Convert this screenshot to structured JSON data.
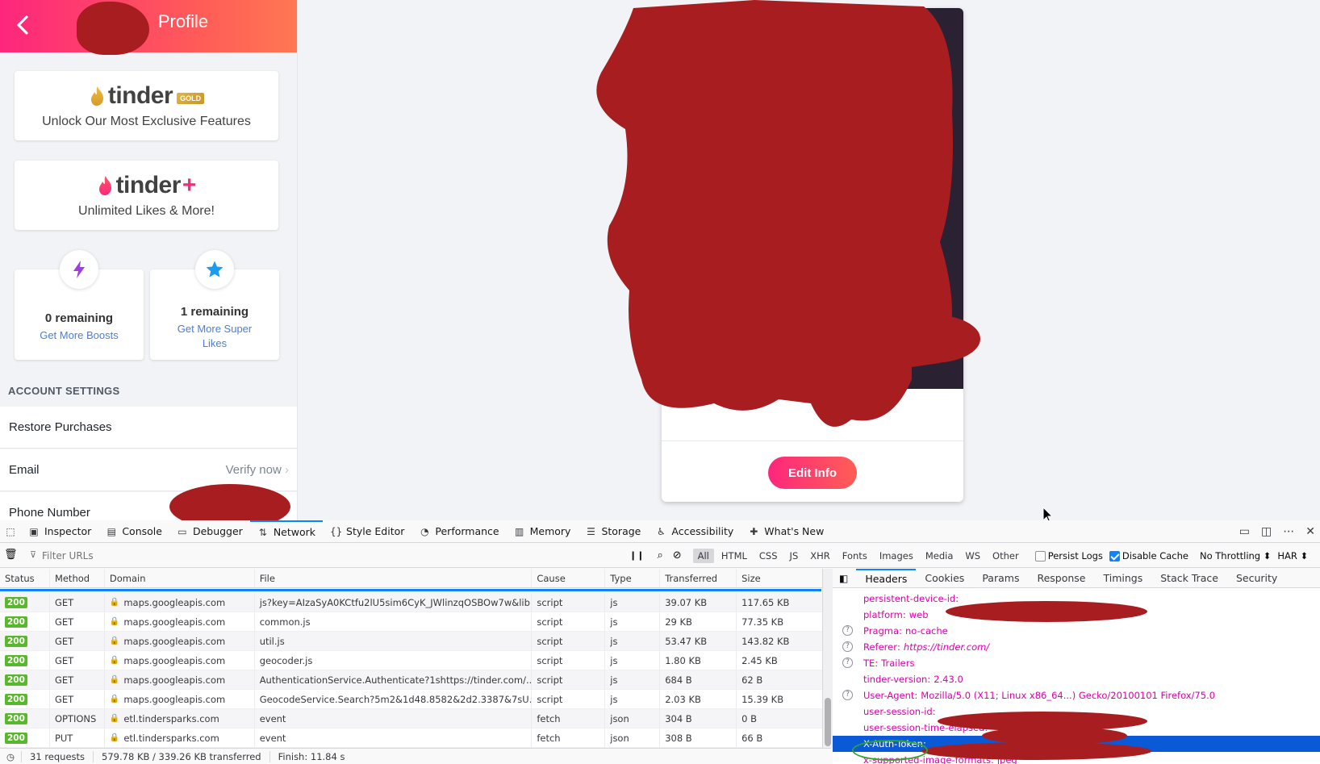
{
  "app": {
    "header_title": "Profile",
    "gold_card": {
      "logo_word": "tinder",
      "badge": "GOLD",
      "subtitle": "Unlock Our Most Exclusive Features"
    },
    "plus_card": {
      "logo_word": "tinder",
      "plus": "+",
      "subtitle": "Unlimited Likes & More!"
    },
    "boosts": {
      "remaining": "0 remaining",
      "link": "Get More Boosts"
    },
    "super_likes": {
      "remaining": "1 remaining",
      "link": "Get More Super Likes"
    },
    "account_settings_header": "ACCOUNT SETTINGS",
    "settings": [
      {
        "label": "Restore Purchases",
        "value": ""
      },
      {
        "label": "Email",
        "value": "Verify now"
      },
      {
        "label": "Phone Number",
        "value": ""
      }
    ],
    "edit_info_button": "Edit Info",
    "colors": {
      "brand_start": "#fd267d",
      "brand_end": "#ff7854",
      "link": "#4c7ed6",
      "redaction": "#a71d20"
    }
  },
  "devtools": {
    "tabs": [
      {
        "label": "Inspector",
        "icon": "inspector-icon"
      },
      {
        "label": "Console",
        "icon": "console-icon"
      },
      {
        "label": "Debugger",
        "icon": "debugger-icon"
      },
      {
        "label": "Network",
        "icon": "network-icon",
        "active": true
      },
      {
        "label": "Style Editor",
        "icon": "style-editor-icon"
      },
      {
        "label": "Performance",
        "icon": "performance-icon"
      },
      {
        "label": "Memory",
        "icon": "memory-icon"
      },
      {
        "label": "Storage",
        "icon": "storage-icon"
      },
      {
        "label": "Accessibility",
        "icon": "accessibility-icon"
      },
      {
        "label": "What's New",
        "icon": "whats-new-icon"
      }
    ],
    "toolbar": {
      "filter_placeholder": "Filter URLs",
      "type_filters": [
        "All",
        "HTML",
        "CSS",
        "JS",
        "XHR",
        "Fonts",
        "Images",
        "Media",
        "WS",
        "Other"
      ],
      "active_filter": "All",
      "persist_logs": "Persist Logs",
      "disable_cache": "Disable Cache",
      "throttling": "No Throttling",
      "har": "HAR"
    },
    "columns": [
      "Status",
      "Method",
      "Domain",
      "File",
      "Cause",
      "Type",
      "Transferred",
      "Size"
    ],
    "requests": [
      {
        "status": "200",
        "method": "GET",
        "domain": "maps.googleapis.com",
        "file": "js?key=AIzaSyA0KCtfu2lU5sim6CyK_JWlinzqOSBOw7w&lib...",
        "cause": "script",
        "type": "js",
        "transferred": "39.07 KB",
        "size": "117.65 KB"
      },
      {
        "status": "200",
        "method": "GET",
        "domain": "maps.googleapis.com",
        "file": "common.js",
        "cause": "script",
        "type": "js",
        "transferred": "29 KB",
        "size": "77.35 KB"
      },
      {
        "status": "200",
        "method": "GET",
        "domain": "maps.googleapis.com",
        "file": "util.js",
        "cause": "script",
        "type": "js",
        "transferred": "53.47 KB",
        "size": "143.82 KB"
      },
      {
        "status": "200",
        "method": "GET",
        "domain": "maps.googleapis.com",
        "file": "geocoder.js",
        "cause": "script",
        "type": "js",
        "transferred": "1.80 KB",
        "size": "2.45 KB"
      },
      {
        "status": "200",
        "method": "GET",
        "domain": "maps.googleapis.com",
        "file": "AuthenticationService.Authenticate?1shttps://tinder.com/...",
        "cause": "script",
        "type": "js",
        "transferred": "684 B",
        "size": "62 B"
      },
      {
        "status": "200",
        "method": "GET",
        "domain": "maps.googleapis.com",
        "file": "GeocodeService.Search?5m2&1d48.8582&2d2.3387&7sU...",
        "cause": "script",
        "type": "js",
        "transferred": "2.03 KB",
        "size": "15.39 KB"
      },
      {
        "status": "200",
        "method": "OPTIONS",
        "domain": "etl.tindersparks.com",
        "file": "event",
        "cause": "fetch",
        "type": "json",
        "transferred": "304 B",
        "size": "0 B"
      },
      {
        "status": "200",
        "method": "PUT",
        "domain": "etl.tindersparks.com",
        "file": "event",
        "cause": "fetch",
        "type": "json",
        "transferred": "308 B",
        "size": "66 B"
      }
    ],
    "status_bar": {
      "requests": "31 requests",
      "transferred": "579.78 KB / 339.26 KB transferred",
      "finish": "Finish: 11.84 s"
    },
    "detail_tabs": [
      "Headers",
      "Cookies",
      "Params",
      "Response",
      "Timings",
      "Stack Trace",
      "Security"
    ],
    "active_detail_tab": "Headers",
    "headers": [
      {
        "name": "persistent-device-id",
        "value": "",
        "help": false
      },
      {
        "name": "platform",
        "value": "web",
        "help": false
      },
      {
        "name": "Pragma",
        "value": "no-cache",
        "help": true
      },
      {
        "name": "Referer",
        "value": "https://tinder.com/",
        "help": true
      },
      {
        "name": "TE",
        "value": "Trailers",
        "help": true
      },
      {
        "name": "tinder-version",
        "value": "2.43.0",
        "help": false
      },
      {
        "name": "User-Agent",
        "value": "Mozilla/5.0 (X11; Linux x86_64...) Gecko/20100101 Firefox/75.0",
        "help": true
      },
      {
        "name": "user-session-id",
        "value": "",
        "help": false
      },
      {
        "name": "user-session-time-elapsed",
        "value": "",
        "help": false
      },
      {
        "name": "X-Auth-Token",
        "value": "",
        "help": false,
        "selected": true
      },
      {
        "name": "x-supported-image-formats",
        "value": "jpeg",
        "help": false
      }
    ]
  }
}
